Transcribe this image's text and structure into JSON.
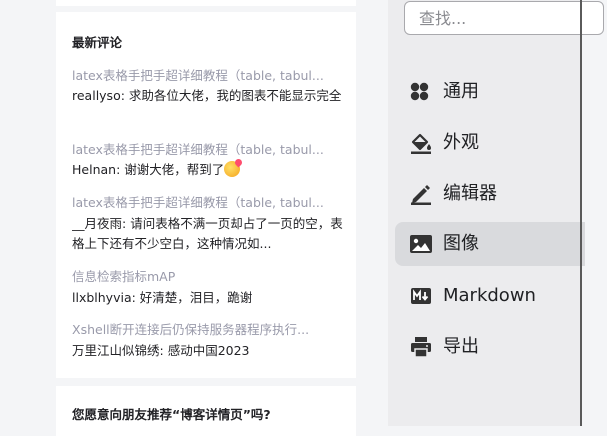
{
  "recent_comments": {
    "title": "最新评论",
    "items": [
      {
        "link": "latex表格手把手超详细教程（table, tabul...",
        "author": "reallyso",
        "text": "求助各位大佬，我的图表不能显示完全",
        "has_emoji": false
      },
      {
        "link": "latex表格手把手超详细教程（table, tabul...",
        "author": "Helnan",
        "text": "谢谢大佬，帮到了",
        "has_emoji": true,
        "emoji": "face-with-heart-icon"
      },
      {
        "link": "latex表格手把手超详细教程（table, tabul...",
        "author": "__月夜雨",
        "text": "请问表格不满一页却占了一页的空，表格上下还有不少空白，这种情况如...",
        "has_emoji": false
      },
      {
        "link": "信息检索指标mAP",
        "author": "llxblhyvia",
        "text": "好清楚，泪目，跪谢",
        "has_emoji": false
      },
      {
        "link": "Xshell断开连接后仍保持服务器程序执行...",
        "author": "万里江山似锦绣",
        "text": "感动中国2023",
        "has_emoji": false
      }
    ]
  },
  "recommend": {
    "title": "您愿意向朋友推荐“博客详情页”吗?"
  },
  "settings": {
    "search_placeholder": "查找...",
    "menu": [
      {
        "label": "通用",
        "icon": "apps-grid-icon",
        "active": false
      },
      {
        "label": "外观",
        "icon": "paint-bucket-icon",
        "active": false
      },
      {
        "label": "编辑器",
        "icon": "pencil-icon",
        "active": false
      },
      {
        "label": "图像",
        "icon": "image-icon",
        "active": true
      },
      {
        "label": "Markdown",
        "icon": "markdown-icon",
        "active": false
      },
      {
        "label": "导出",
        "icon": "printer-icon",
        "active": false
      }
    ]
  },
  "colors": {
    "text_primary": "#222226",
    "text_link": "#999aaa",
    "panel_bg": "#ececee",
    "active_bg": "#d9dadd"
  }
}
